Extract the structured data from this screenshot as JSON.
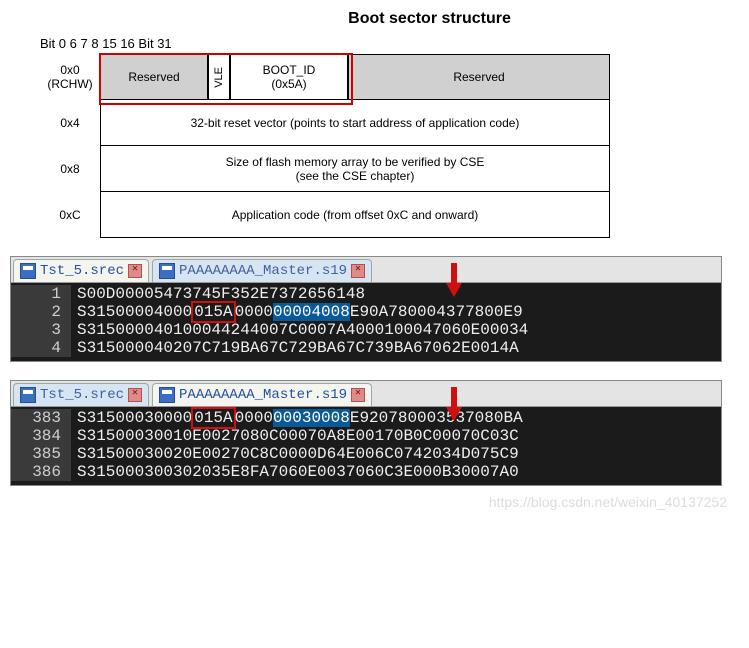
{
  "title": "Boot sector structure",
  "bits": {
    "b0": "Bit 0",
    "b6": "6",
    "b7": "7",
    "b8": "8",
    "b15": "15",
    "b16": "16",
    "b31": "Bit 31"
  },
  "rows": {
    "r0": {
      "addr_hex": "0x0",
      "addr_name": "(RCHW)",
      "reserved1": "Reserved",
      "vle": "VLE",
      "boot_id": "BOOT_ID\n(0x5A)",
      "reserved2": "Reserved"
    },
    "r1": {
      "addr": "0x4",
      "text": "32-bit reset vector (points to start address of application code)"
    },
    "r2": {
      "addr": "0x8",
      "text": "Size of flash memory array to be verified by CSE\n(see the CSE chapter)"
    },
    "r3": {
      "addr": "0xC",
      "text": "Application code (from offset 0xC and onward)"
    }
  },
  "editor1": {
    "tab1": "Tst_5.srec",
    "tab2": "PAAAAAAAA_Master.s19",
    "lines": [
      {
        "n": "1",
        "pre": "S00D00005473745F352E73726561",
        "red": "",
        "mid": "",
        "blue": "",
        "post": "48"
      },
      {
        "n": "2",
        "pre": "S31500004000",
        "red": "015A",
        "mid": "0000",
        "blue": "00004008",
        "post": "E90A780004377800E9"
      },
      {
        "n": "3",
        "pre": "S315000040100044244007C0007A4000100047060E00034",
        "red": "",
        "mid": "",
        "blue": "",
        "post": ""
      },
      {
        "n": "4",
        "pre": "S315000040207C719BA67C729BA67C739BA67062E0014A",
        "red": "",
        "mid": "",
        "blue": "",
        "post": ""
      }
    ]
  },
  "editor2": {
    "tab1": "Tst_5.srec",
    "tab2": "PAAAAAAAA_Master.s19",
    "lines": [
      {
        "n": "383",
        "pre": "S31500030000",
        "red": "015A",
        "mid": "0000",
        "blue": "00030008",
        "post": "E920780003537080BA"
      },
      {
        "n": "384",
        "pre": "S31500030010E0027080C00070A8E00170B0C00070C03C",
        "red": "",
        "mid": "",
        "blue": "",
        "post": ""
      },
      {
        "n": "385",
        "pre": "S31500030020E00270C8C0000D64E006C0742034D075C9",
        "red": "",
        "mid": "",
        "blue": "",
        "post": ""
      },
      {
        "n": "386",
        "pre": "S315000300302035E8FA7060E0037060C3E000B30007A0",
        "red": "",
        "mid": "",
        "blue": "",
        "post": ""
      }
    ]
  },
  "watermark": "https://blog.csdn.net/weixin_40137252"
}
